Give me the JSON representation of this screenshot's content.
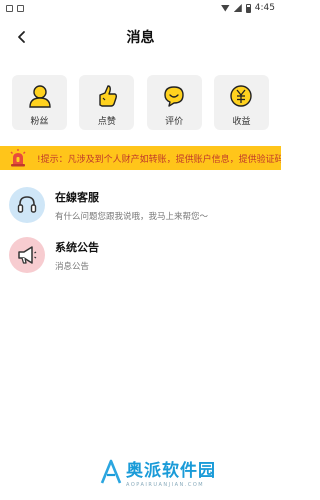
{
  "status_bar": {
    "time": "4:45"
  },
  "header": {
    "title": "消息"
  },
  "tiles": [
    {
      "label": "粉丝",
      "icon": "fans-icon"
    },
    {
      "label": "点赞",
      "icon": "like-icon"
    },
    {
      "label": "评价",
      "icon": "comment-icon"
    },
    {
      "label": "收益",
      "icon": "income-icon"
    }
  ],
  "notice": {
    "text": "!提示：凡涉及到个人财产如转账，提供账户信息，提供验证码等",
    "icon": "alarm-icon"
  },
  "messages": [
    {
      "title": "在線客服",
      "subtitle": "有什么问题您跟我说哦，我马上来帮您～",
      "icon": "headset-icon"
    },
    {
      "title": "系统公告",
      "subtitle": "消息公告",
      "icon": "megaphone-icon"
    }
  ],
  "watermark": {
    "main": "奥派软件园",
    "sub": "AOPAIRUANJIAN.COM"
  },
  "colors": {
    "accent": "#ffc51a",
    "notice_text": "#c0392b",
    "service_bg": "#cfe6f7",
    "announce_bg": "#f7ccd0"
  }
}
